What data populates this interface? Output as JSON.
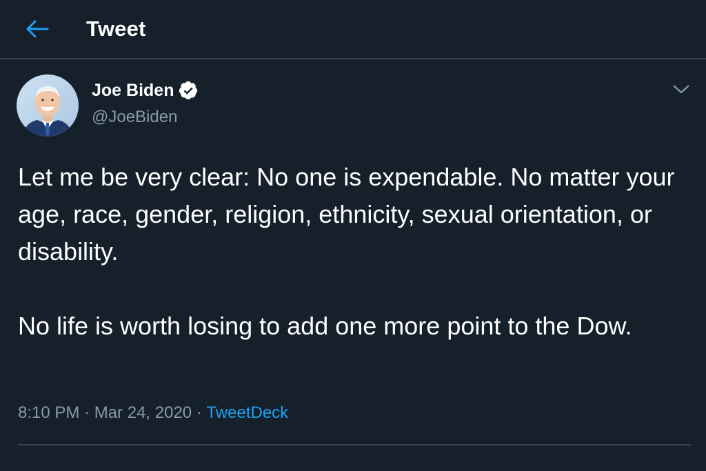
{
  "header": {
    "title": "Tweet",
    "back_icon": "arrow-left-icon"
  },
  "author": {
    "name": "Joe Biden",
    "handle": "@JoeBiden",
    "verified_icon": "verified-badge-icon",
    "avatar": "avatar-photo"
  },
  "menu": {
    "icon": "chevron-down-icon"
  },
  "tweet": {
    "text": "Let me be very clear: No one is expendable. No matter your age, race, gender, religion, ethnicity, sexual orientation, or disability.\n\nNo life is worth losing to add one more point to the Dow."
  },
  "meta": {
    "time": "8:10 PM",
    "separator": " · ",
    "date": "Mar 24, 2020",
    "source": "TweetDeck"
  },
  "colors": {
    "background": "#15202b",
    "accent": "#1da1f2",
    "secondary_text": "#8899a6",
    "border": "#38444d"
  }
}
